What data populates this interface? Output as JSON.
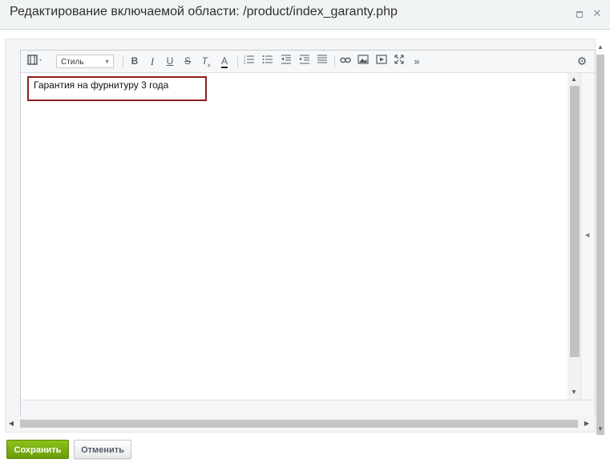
{
  "dialog": {
    "title": "Редактирование включаемой области: /product/index_garanty.php"
  },
  "toolbar": {
    "style_select": "Стиль",
    "icons": [
      "view-mode-icon",
      "bold-icon",
      "italic-icon",
      "underline-icon",
      "strikethrough-icon",
      "remove-format-icon",
      "font-color-icon",
      "ordered-list-icon",
      "unordered-list-icon",
      "outdent-icon",
      "indent-icon",
      "align-icon",
      "link-icon",
      "image-icon",
      "video-icon",
      "fullscreen-icon",
      "more-icon",
      "settings-icon"
    ]
  },
  "editor": {
    "content": "Гарантия на фурнитуру 3 года"
  },
  "buttons": {
    "save": "Сохранить",
    "cancel": "Отменить"
  },
  "colors": {
    "save_button": "#7aad10",
    "highlight_border": "#8b1e1e"
  }
}
